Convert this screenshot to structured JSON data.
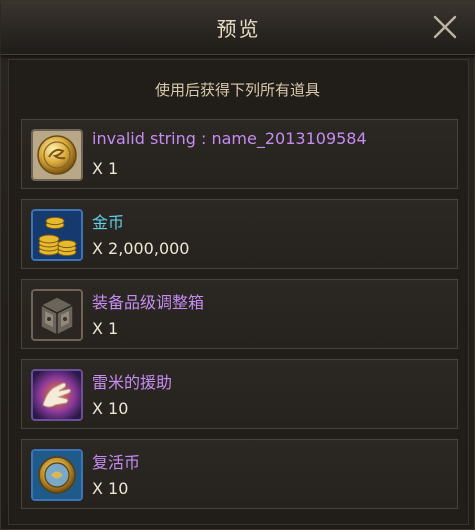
{
  "dialog": {
    "title": "预览",
    "subtitle": "使用后获得下列所有道具"
  },
  "items": [
    {
      "name": "invalid string : name_2013109584",
      "quantity": "X 1",
      "name_color": "#c68cf2",
      "icon": "gold-medal-icon"
    },
    {
      "name": "金币",
      "quantity": "X 2,000,000",
      "name_color": "#5fd0e6",
      "icon": "gold-coins-icon"
    },
    {
      "name": "装备品级调整箱",
      "quantity": "X 1",
      "name_color": "#c68cf2",
      "icon": "equipment-box-icon"
    },
    {
      "name": "雷米的援助",
      "quantity": "X 10",
      "name_color": "#c68cf2",
      "icon": "helping-hand-icon"
    },
    {
      "name": "复活币",
      "quantity": "X 10",
      "name_color": "#c68cf2",
      "icon": "revive-coin-icon"
    }
  ]
}
